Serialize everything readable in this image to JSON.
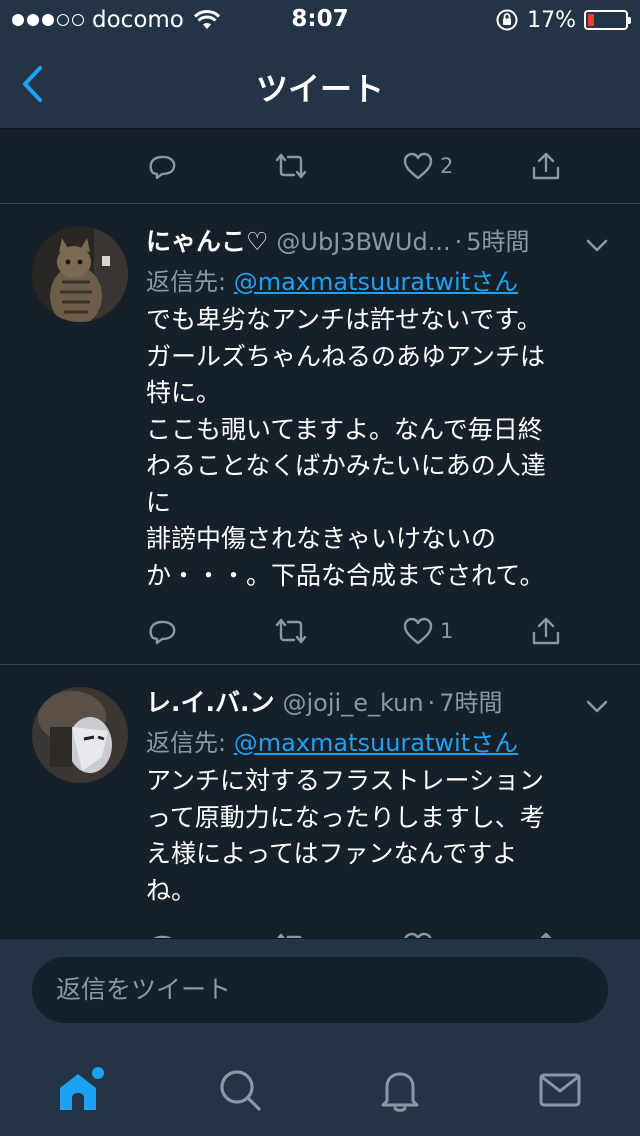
{
  "status_bar": {
    "carrier": "docomo",
    "time": "8:07",
    "battery_percent": "17%",
    "battery_level": 0.17,
    "battery_color": "#ff3b30"
  },
  "nav": {
    "title": "ツイート",
    "back_icon": "chevron-left-icon"
  },
  "colors": {
    "background": "#15202b",
    "bar_background": "#243447",
    "accent": "#1da1f2",
    "secondary_text": "#8899a6",
    "divider": "#38444d"
  },
  "top_actions": {
    "like_count": "2"
  },
  "tweets": [
    {
      "name": "にゃんこ♡",
      "handle": "@UbJ3BWUd...",
      "separator": "·",
      "time": "5時間",
      "reply_prefix": "返信先: ",
      "reply_handle": "@maxmatsuuratwitさん",
      "text": "でも卑劣なアンチは許せないです。\nガールズちゃんねるのあゆアンチは\n特に。\nここも覗いてますよ。なんで毎日終\nわることなくばかみたいにあの人達\nに\n誹謗中傷されなきゃいけないの\nか・・・。下品な合成までされて。",
      "like_count": "1"
    },
    {
      "name": "レ.イ.バ.ン",
      "handle": "@joji_e_kun",
      "separator": "·",
      "time": "7時間",
      "reply_prefix": "返信先: ",
      "reply_handle": "@maxmatsuuratwitさん",
      "text": "アンチに対するフラストレーション\nって原動力になったりしますし、考\nえ様によってはファンなんですよ\nね。"
    }
  ],
  "reply_bar": {
    "placeholder": "返信をツイート"
  },
  "tabs": [
    {
      "name": "home",
      "icon": "home-icon",
      "active": true
    },
    {
      "name": "search",
      "icon": "search-icon",
      "active": false
    },
    {
      "name": "notifications",
      "icon": "bell-icon",
      "active": false
    },
    {
      "name": "messages",
      "icon": "mail-icon",
      "active": false
    }
  ]
}
